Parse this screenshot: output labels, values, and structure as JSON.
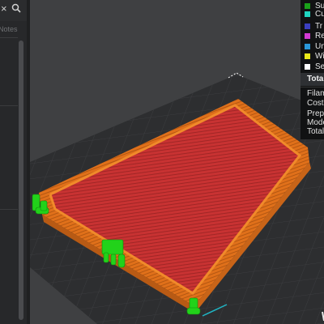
{
  "sidebar": {
    "close_glyph": "×",
    "search_icon": "search-icon",
    "notes_tab": "Notes"
  },
  "legend": {
    "items": [
      {
        "label": "Su",
        "color": "#1aa11a"
      },
      {
        "label": "Cu",
        "color": "#1fd5c0"
      },
      {
        "label": "Tr",
        "color": "#3b3fbf"
      },
      {
        "label": "Re",
        "color": "#d23ad2"
      },
      {
        "label": "Un",
        "color": "#2a97d8"
      },
      {
        "label": "Wi",
        "color": "#e8e81a"
      },
      {
        "label": "Se",
        "color": "#ffffff"
      }
    ],
    "header": "Total",
    "stats": [
      "Filame",
      "Cost:",
      "Prepa",
      "Mode",
      "Total"
    ]
  },
  "colors": {
    "background": "#3f4042",
    "bed": "#2d2e30",
    "wall": "#e0701a",
    "infill": "#c83232",
    "support": "#22d21a"
  }
}
